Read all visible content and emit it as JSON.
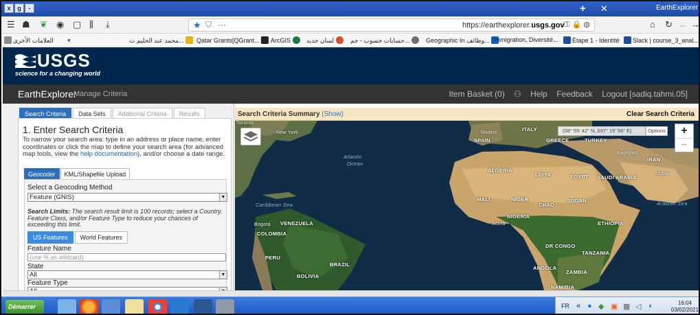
{
  "browser": {
    "window_buttons": [
      "x",
      "g",
      "-"
    ],
    "tab_title": "EarthExplorer",
    "url_prefix": "https://earthexplorer.",
    "url_domain": "usgs.gov",
    "bookmarks": [
      {
        "label": "العلامات الأخرى",
        "color": "#8a8a8a"
      },
      {
        "label": "محمد عبد الحليم ت...",
        "color": "#e5b11f"
      },
      {
        "label": "Qatar Grants[QGrant...",
        "color": "#222222"
      },
      {
        "label": "ArcGIS",
        "color": "#1f7a3d"
      },
      {
        "label": "لسان جديد",
        "color": "#e04a2a"
      },
      {
        "label": "حسابات جسوب - جم...",
        "color": "#6e6e6e"
      },
      {
        "label": "Geographic In وظائف...",
        "color": "#0a66c2"
      },
      {
        "label": "Immigration, Diversité...",
        "color": "#0a66c2"
      },
      {
        "label": "Étape 1 - Identité",
        "color": "#1f4e9c"
      },
      {
        "label": "Slack | course_3_anal...",
        "color": "#3da55a"
      }
    ]
  },
  "header": {
    "logo": "USGS",
    "tagline": "science for a changing world"
  },
  "appbar": {
    "brand": "EarthExplorer",
    "manage": "Manage Criteria",
    "item_basket": "Item Basket (0)",
    "help": "Help",
    "feedback": "Feedback",
    "logout": "Logout [sadiq.tahmi.05]"
  },
  "left": {
    "tabs": [
      "Search Criteria",
      "Data Sets",
      "Additional Criteria",
      "Results"
    ],
    "heading": "1. Enter Search Criteria",
    "intro_before": "To narrow your search area: type in an address or place name, enter coordinates or click the map to define your search area (for advanced map tools, view the ",
    "intro_link": "help documentation",
    "intro_after": "), and/or choose a date range.",
    "subtabs": [
      "Geocoder",
      "KML/Shapefile Upload"
    ],
    "method_label": "Select a Geocoding Method",
    "method_value": "Feature (GNIS)",
    "limits_bold": "Search Limits:",
    "limits_text": " The search result limit is 100 records; select a Country, Feature Class, and/or Feature Type to reduce your chances of exceeding this limit.",
    "feature_tabs": [
      "US Features",
      "World Features"
    ],
    "feature_name_label": "Feature Name",
    "feature_name_placeholder": "(use % as wildcard)",
    "state_label": "State",
    "state_value": "All",
    "type_label": "Feature Type",
    "type_value": "All"
  },
  "map": {
    "summary_title": "Search Criteria Summary",
    "summary_show": "(Show)",
    "clear": "Clear Search Criteria",
    "coords": "(08° 55' 42\" N, 037° 15' 56\" E)",
    "options": "Options",
    "zoom_in": "+",
    "zoom_out": "−",
    "places": [
      "Toronto",
      "New York",
      "Atlantic",
      "Ocean",
      "Madrid",
      "SPAIN",
      "ITALY",
      "GREECE",
      "TURKEY",
      "Baghdad",
      "IRAN",
      "ALGERIA",
      "LIBYA",
      "EGYPT",
      "SAUDI ARABIA",
      "Dubai",
      "MALI",
      "NIGER",
      "CHAD",
      "SUDAN",
      "Arabian Sea",
      "Caribbean Sea",
      "Bogotá",
      "VENEZUELA",
      "NIGERIA",
      "Accra",
      "ETHIOPIA",
      "COLOMBIA",
      "DR CONGO",
      "TANZANIA",
      "PERU",
      "BRAZIL",
      "ANGOLA",
      "ZAMBIA",
      "BOLIVIA",
      "NAMIBIA"
    ]
  },
  "taskbar": {
    "start": "Démarrer",
    "lang": "FR",
    "time": "16:04",
    "date": "03/02/2021"
  }
}
